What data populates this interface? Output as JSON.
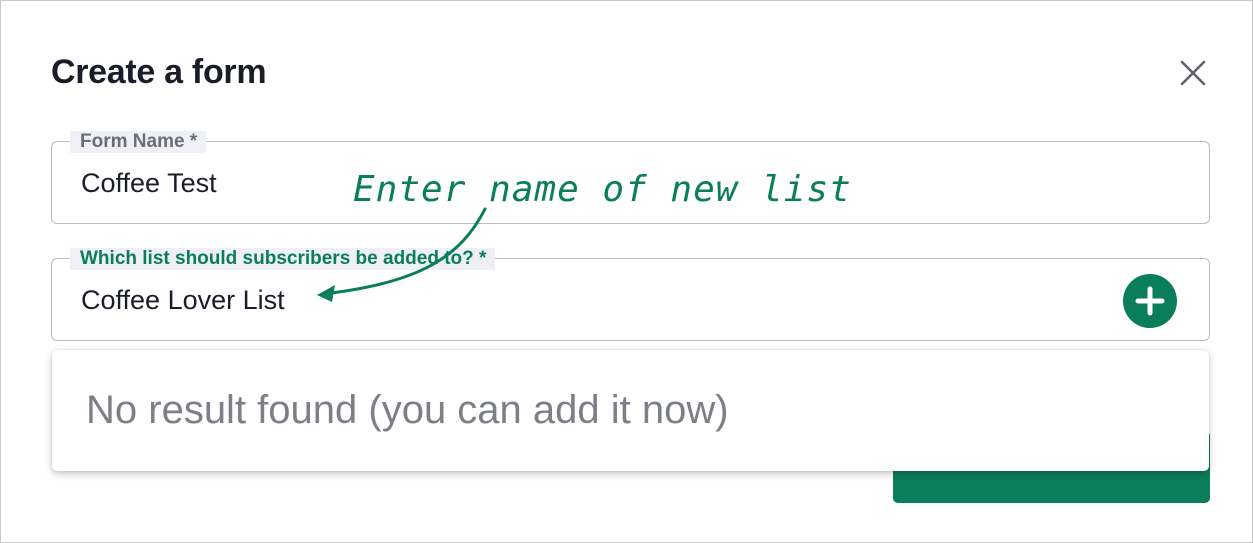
{
  "dialog": {
    "title": "Create a form",
    "close_icon": "close-icon"
  },
  "form_name": {
    "label": "Form Name *",
    "value": "Coffee Test"
  },
  "list_field": {
    "label": "Which list should subscribers be added to? *",
    "value": "Coffee Lover List",
    "add_icon": "plus-circle-icon"
  },
  "dropdown": {
    "message": "No result found (you can add it now)"
  },
  "annotation": {
    "text": "Enter name of new list"
  },
  "colors": {
    "accent": "#0a7d5a",
    "title": "#1a1d29",
    "muted_label": "#6b6e78",
    "placeholder_text": "#7d7f86"
  }
}
